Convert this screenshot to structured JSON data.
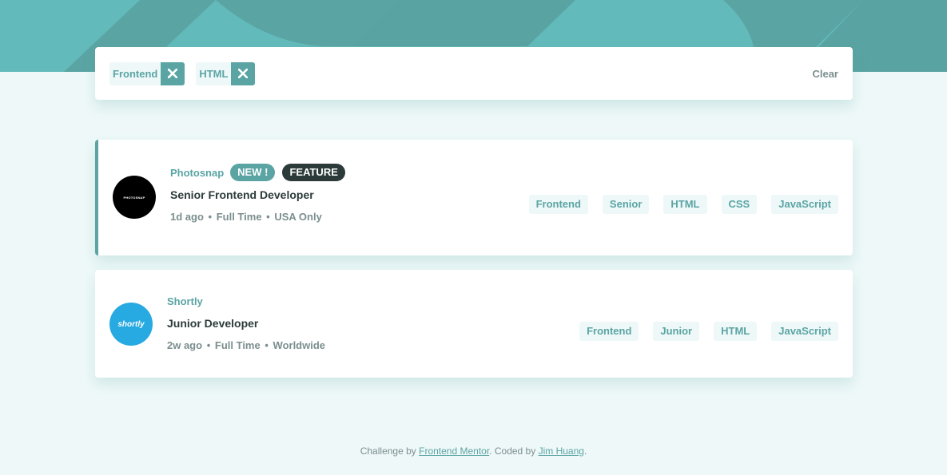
{
  "colors": {
    "primary": "#5ba4a4",
    "hero": "#62baba",
    "background": "#eef8f8",
    "dark": "#2c3a3a",
    "muted": "#7b8e8e"
  },
  "filters": {
    "active": [
      {
        "label": "Frontend",
        "remove_icon": "close-icon"
      },
      {
        "label": "HTML",
        "remove_icon": "close-icon"
      }
    ],
    "clear_label": "Clear"
  },
  "jobs": [
    {
      "company": "Photosnap",
      "logo_text": "PHOTOSNAP",
      "new_badge": "NEW !",
      "featured_badge": "FEATURE",
      "position": "Senior Frontend Developer",
      "posted_at": "1d ago",
      "contract": "Full Time",
      "location": "USA Only",
      "tags": [
        "Frontend",
        "Senior",
        "HTML",
        "CSS",
        "JavaScript"
      ]
    },
    {
      "company": "Shortly",
      "logo_text": "shortly",
      "position": "Junior Developer",
      "posted_at": "2w ago",
      "contract": "Full Time",
      "location": "Worldwide",
      "tags": [
        "Frontend",
        "Junior",
        "HTML",
        "JavaScript"
      ]
    }
  ],
  "footer": {
    "prefix": "Challenge by",
    "link1": "Frontend Mentor",
    "middle": ". Coded by",
    "link2": "Jim Huang",
    "suffix": "."
  },
  "meta_separator": "•"
}
